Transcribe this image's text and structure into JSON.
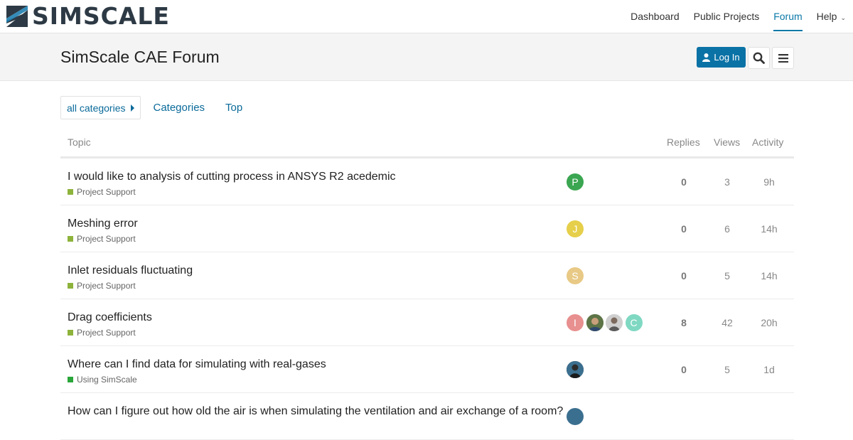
{
  "brand": {
    "name": "SIMSCALE"
  },
  "topnav": {
    "links": [
      {
        "label": "Dashboard"
      },
      {
        "label": "Public Projects"
      },
      {
        "label": "Forum"
      },
      {
        "label": "Help"
      }
    ]
  },
  "header": {
    "title": "SimScale CAE Forum",
    "login_label": "Log In"
  },
  "filters": {
    "category_dropdown": "all categories",
    "links": [
      "Categories",
      "Top"
    ]
  },
  "table": {
    "columns": {
      "topic": "Topic",
      "replies": "Replies",
      "views": "Views",
      "activity": "Activity"
    },
    "rows": [
      {
        "title": "I would like to analysis of cutting process in ANSYS R2 acedemic",
        "category": "Project Support",
        "replies": "0",
        "views": "3",
        "activity": "9h",
        "avatars": [
          "P"
        ]
      },
      {
        "title": "Meshing error",
        "category": "Project Support",
        "replies": "0",
        "views": "6",
        "activity": "14h",
        "avatars": [
          "J"
        ]
      },
      {
        "title": "Inlet residuals fluctuating",
        "category": "Project Support",
        "replies": "0",
        "views": "5",
        "activity": "14h",
        "avatars": [
          "S"
        ]
      },
      {
        "title": "Drag coefficients",
        "category": "Project Support",
        "replies": "8",
        "views": "42",
        "activity": "20h",
        "avatars": [
          "I",
          "",
          "",
          "C"
        ]
      },
      {
        "title": "Where can I find data for simulating with real-gases",
        "category": "Using SimScale",
        "replies": "0",
        "views": "5",
        "activity": "1d",
        "avatars": [
          ""
        ]
      },
      {
        "title": "How can I figure out how old the air is when simulating the ventilation and air exchange of a room?",
        "category": "",
        "replies": "",
        "views": "",
        "activity": "",
        "avatars": [
          ""
        ]
      }
    ]
  },
  "colors": {
    "accent": "#0a78a8",
    "login_button": "#0b72a6",
    "category_project_support": "#8db33b",
    "category_using_simscale": "#2aa63a",
    "avatar_p": "#3aa651",
    "avatar_j": "#e6cf4a",
    "avatar_s": "#e8c985",
    "avatar_i": "#e88f8f",
    "avatar_c": "#7fd8c2"
  }
}
